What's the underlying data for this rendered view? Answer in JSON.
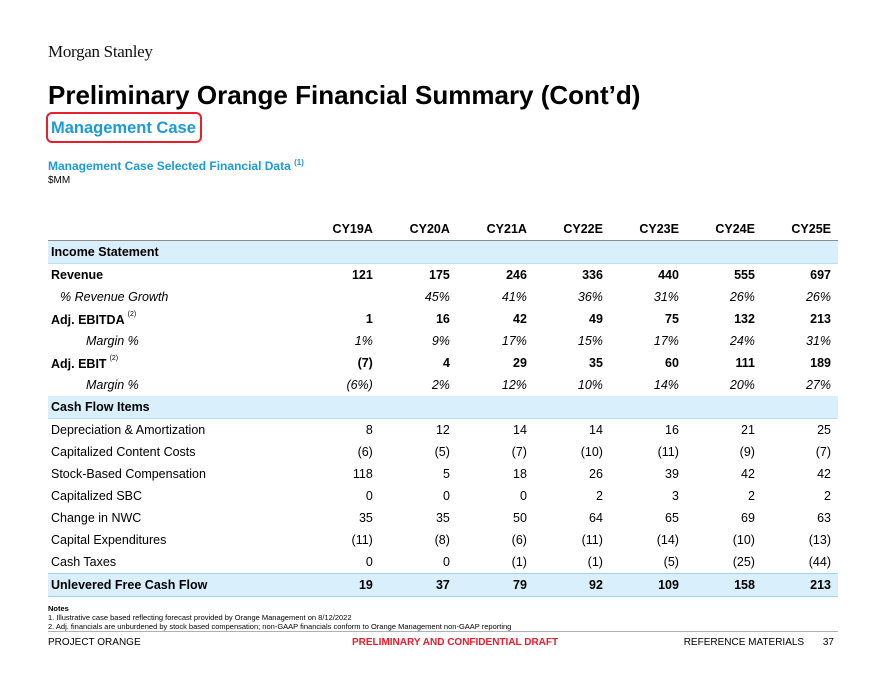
{
  "brand": "Morgan Stanley",
  "title": "Preliminary Orange Financial Summary (Cont’d)",
  "subtitle": "Management Case",
  "section_title": "Management Case Selected Financial Data",
  "section_note": "(1)",
  "units": "$MM",
  "columns": [
    "CY19A",
    "CY20A",
    "CY21A",
    "CY22E",
    "CY23E",
    "CY24E",
    "CY25E"
  ],
  "income_statement": {
    "header": "Income Statement",
    "revenue": {
      "label": "Revenue",
      "values": [
        "121",
        "175",
        "246",
        "336",
        "440",
        "555",
        "697"
      ]
    },
    "revenue_growth": {
      "label": "% Revenue Growth",
      "values": [
        "",
        "45%",
        "41%",
        "36%",
        "31%",
        "26%",
        "26%"
      ]
    },
    "adj_ebitda": {
      "label": "Adj. EBITDA",
      "note": "(2)",
      "values": [
        "1",
        "16",
        "42",
        "49",
        "75",
        "132",
        "213"
      ]
    },
    "ebitda_margin": {
      "label": "Margin %",
      "values": [
        "1%",
        "9%",
        "17%",
        "15%",
        "17%",
        "24%",
        "31%"
      ]
    },
    "adj_ebit": {
      "label": "Adj. EBIT",
      "note": "(2)",
      "values": [
        "(7)",
        "4",
        "29",
        "35",
        "60",
        "111",
        "189"
      ]
    },
    "ebit_margin": {
      "label": "Margin %",
      "values": [
        "(6%)",
        "2%",
        "12%",
        "10%",
        "14%",
        "20%",
        "27%"
      ]
    }
  },
  "cash_flow": {
    "header": "Cash Flow Items",
    "rows": [
      {
        "label": "Depreciation & Amortization",
        "values": [
          "8",
          "12",
          "14",
          "14",
          "16",
          "21",
          "25"
        ]
      },
      {
        "label": "Capitalized Content Costs",
        "values": [
          "(6)",
          "(5)",
          "(7)",
          "(10)",
          "(11)",
          "(9)",
          "(7)"
        ]
      },
      {
        "label": "Stock-Based Compensation",
        "values": [
          "118",
          "5",
          "18",
          "26",
          "39",
          "42",
          "42"
        ]
      },
      {
        "label": "Capitalized SBC",
        "values": [
          "0",
          "0",
          "0",
          "2",
          "3",
          "2",
          "2"
        ]
      },
      {
        "label": "Change in NWC",
        "values": [
          "35",
          "35",
          "50",
          "64",
          "65",
          "69",
          "63"
        ]
      },
      {
        "label": "Capital Expenditures",
        "values": [
          "(11)",
          "(8)",
          "(6)",
          "(11)",
          "(14)",
          "(10)",
          "(13)"
        ]
      },
      {
        "label": "Cash Taxes",
        "values": [
          "0",
          "0",
          "(1)",
          "(1)",
          "(5)",
          "(25)",
          "(44)"
        ]
      }
    ],
    "total": {
      "label": "Unlevered Free Cash Flow",
      "values": [
        "19",
        "37",
        "79",
        "92",
        "109",
        "158",
        "213"
      ]
    }
  },
  "notes": {
    "header": "Notes",
    "items": [
      "1.   Illustrative case based reflecting forecast provided by Orange Management on 8/12/2022",
      "2.   Adj. financials are unburdened by stock based compensation; non-GAAP financials conform to Orange Management non-GAAP reporting"
    ]
  },
  "footer": {
    "left": "PROJECT ORANGE",
    "center": "PRELIMINARY AND CONFIDENTIAL DRAFT",
    "right": "REFERENCE MATERIALS",
    "page": "37"
  },
  "colors": {
    "accent_blue": "#1d9bd7",
    "highlight_red": "#e4202e",
    "band_fill": "#d9effb"
  }
}
